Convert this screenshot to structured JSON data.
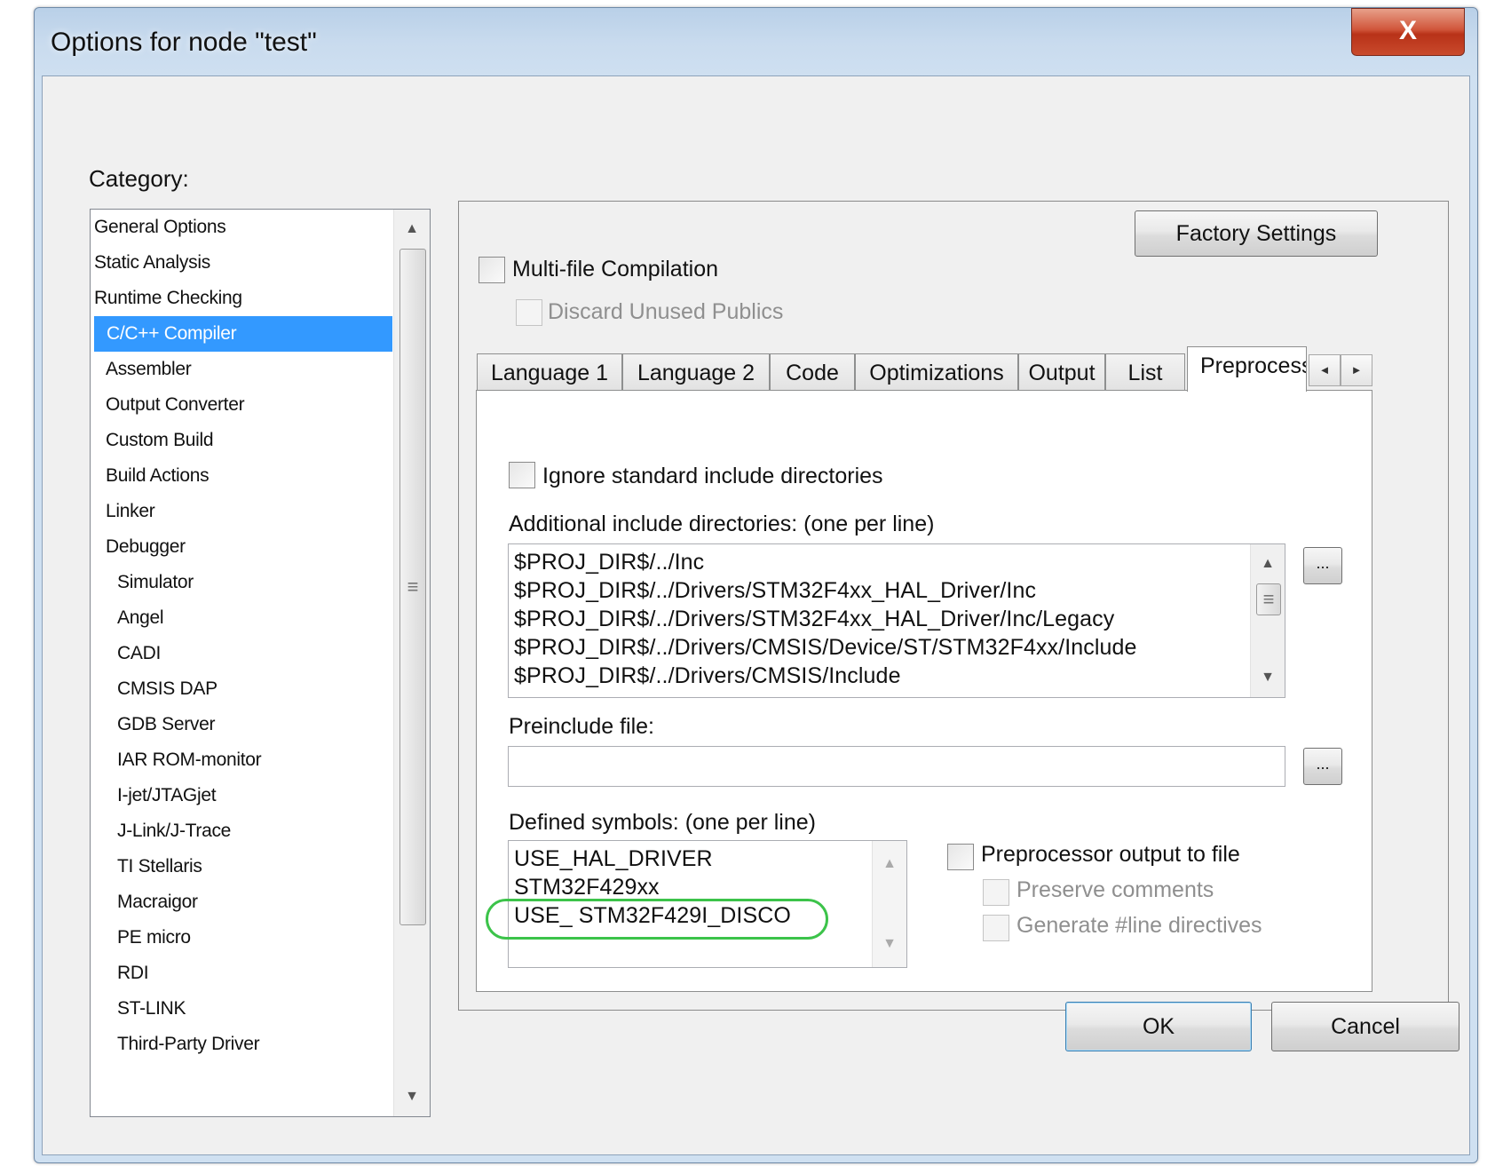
{
  "window": {
    "title": "Options for node \"test\"",
    "close_label": "X"
  },
  "category": {
    "label": "Category:",
    "items": [
      "General Options",
      "Static Analysis",
      "Runtime Checking",
      "C/C++ Compiler",
      "Assembler",
      "Output Converter",
      "Custom Build",
      "Build Actions",
      "Linker",
      "Debugger",
      "Simulator",
      "Angel",
      "CADI",
      "CMSIS DAP",
      "GDB Server",
      "IAR ROM-monitor",
      "I-jet/JTAGjet",
      "J-Link/J-Trace",
      "TI Stellaris",
      "Macraigor",
      "PE micro",
      "RDI",
      "ST-LINK",
      "Third-Party Driver"
    ],
    "selected": "C/C++ Compiler"
  },
  "panel": {
    "factory_settings_label": "Factory Settings",
    "multi_file_label": "Multi-file Compilation",
    "multi_file_checked": false,
    "discard_unused_label": "Discard Unused Publics",
    "discard_unused_checked": false
  },
  "tabs": {
    "items": [
      "Language 1",
      "Language 2",
      "Code",
      "Optimizations",
      "Output",
      "List",
      "Preprocessor"
    ],
    "active": "Preprocessor",
    "scroll_left": "◄",
    "scroll_right": "►"
  },
  "preprocessor": {
    "ignore_std_label": "Ignore standard include directories",
    "ignore_std_checked": false,
    "include_dirs_label": "Additional include directories: (one per line)",
    "include_dirs": [
      "$PROJ_DIR$/../Inc",
      "$PROJ_DIR$/../Drivers/STM32F4xx_HAL_Driver/Inc",
      "$PROJ_DIR$/../Drivers/STM32F4xx_HAL_Driver/Inc/Legacy",
      "$PROJ_DIR$/../Drivers/CMSIS/Device/ST/STM32F4xx/Include",
      "$PROJ_DIR$/../Drivers/CMSIS/Include"
    ],
    "browse_label": "...",
    "preinclude_label": "Preinclude file:",
    "preinclude_value": "",
    "defined_symbols_label": "Defined symbols: (one per line)",
    "defined_symbols": [
      "USE_HAL_DRIVER",
      "STM32F429xx",
      "USE_ STM32F429I_DISCO"
    ],
    "pp_output_label": "Preprocessor output to file",
    "pp_output_checked": false,
    "preserve_comments_label": "Preserve comments",
    "generate_line_label": "Generate #line directives"
  },
  "buttons": {
    "ok": "OK",
    "cancel": "Cancel"
  },
  "colors": {
    "selection": "#3399ff",
    "highlight_oval": "#3cc34a",
    "close_button": "#c94a2c"
  }
}
